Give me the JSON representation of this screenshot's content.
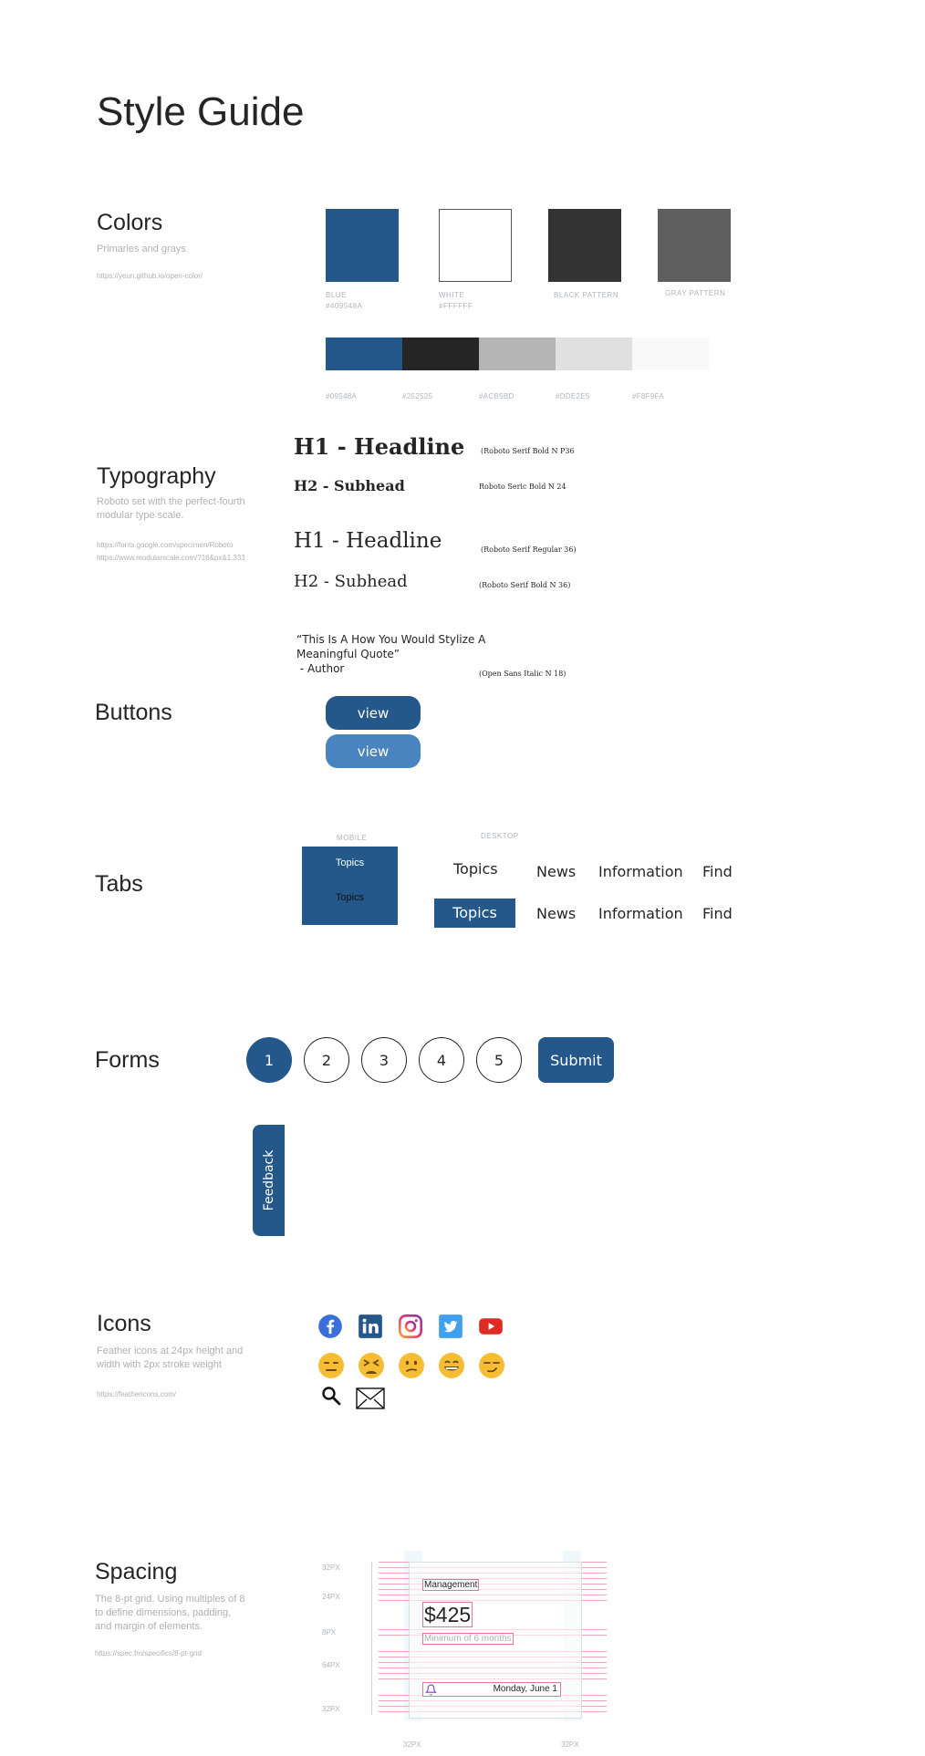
{
  "title": "Style Guide",
  "colors": {
    "title": "Colors",
    "subtitle": "Primaries and grays",
    "link": "https://yeun.github.io/open-color/",
    "swatches": [
      {
        "name": "BLUE",
        "hex": "#409548A",
        "color": "#24578a"
      },
      {
        "name": "WHITE",
        "hex": "#FFFFFF",
        "color": "#ffffff"
      },
      {
        "name": "BLACK PATTERN",
        "hex": "",
        "color": "#333333"
      },
      {
        "name": "GRAY PATTERN",
        "hex": "",
        "color": "#5e5e5e"
      }
    ],
    "strip": [
      {
        "hex": "#09548A",
        "color": "#24578a"
      },
      {
        "hex": "#252525",
        "color": "#252525"
      },
      {
        "hex": "#ACB5BD",
        "color": "#b4b4b4"
      },
      {
        "hex": "#DDE2E5",
        "color": "#e0e0e0"
      },
      {
        "hex": "#F8F9FA",
        "color": "#f8f8f8"
      }
    ]
  },
  "typography": {
    "title": "Typography",
    "subtitle": "Roboto set with the perfect-fourth modular type scale.",
    "links": [
      "https://fonts.google.com/specimen/Roboto",
      "https://www.modularscale.com/?16&px&1.333"
    ],
    "h1_bold": "H1 - Headline",
    "h1_bold_note": "(Roboto Serif Bold N P36",
    "h2_bold": "H2 - Subhead",
    "h2_bold_note": "Roboto Seric  Bold N 24",
    "h1_regular": "H1 - Headline",
    "h1_regular_note": "(Roboto Serif Regular 36)",
    "h2_regular": "H2 - Subhead",
    "h2_regular_note": "(Roboto Serif  Bold N 36)",
    "quote_line1": "“This Is A How You Would Stylize A",
    "quote_line2": "Meaningful Quote”",
    "quote_author": " - Author",
    "quote_note": "(Open Sans Italic N 18)"
  },
  "buttons": {
    "title": "Buttons",
    "primary_label": "view",
    "secondary_label": "view",
    "primary_color": "#24578a",
    "secondary_color": "#4a84c0"
  },
  "tabs": {
    "title": "Tabs",
    "mobile_label": "MOBILE",
    "desktop_label": "DESKTOP",
    "mobile_items": [
      "Topics",
      "Topics"
    ],
    "desktop_row1": [
      "Topics",
      "News",
      "Information",
      "Find"
    ],
    "desktop_row2": [
      "Topics",
      "News",
      "Information",
      "Find"
    ]
  },
  "forms": {
    "title": "Forms",
    "steps": [
      "1",
      "2",
      "3",
      "4",
      "5"
    ],
    "submit_label": "Submit",
    "feedback_label": "Feedback"
  },
  "icons": {
    "title": "Icons",
    "subtitle": "Feather icons at 24px height and width with 2px stroke weight",
    "link": "https://feathericons.com/"
  },
  "spacing": {
    "title": "Spacing",
    "subtitle": "The 8-pt grid. Using multiples of 8 to define dimensions, padding, and margin of elements.",
    "link": "https://spec.fm/specifics/8-pt-grid",
    "labels": [
      "32PX",
      "24PX",
      "8PX",
      "64PX",
      "32PX"
    ],
    "bottom_labels": [
      "32PX",
      "32PX"
    ],
    "card_label": "Management",
    "card_price": "$425",
    "card_minimum": "Minimum of 6 months",
    "card_date": "Monday, June 1"
  }
}
